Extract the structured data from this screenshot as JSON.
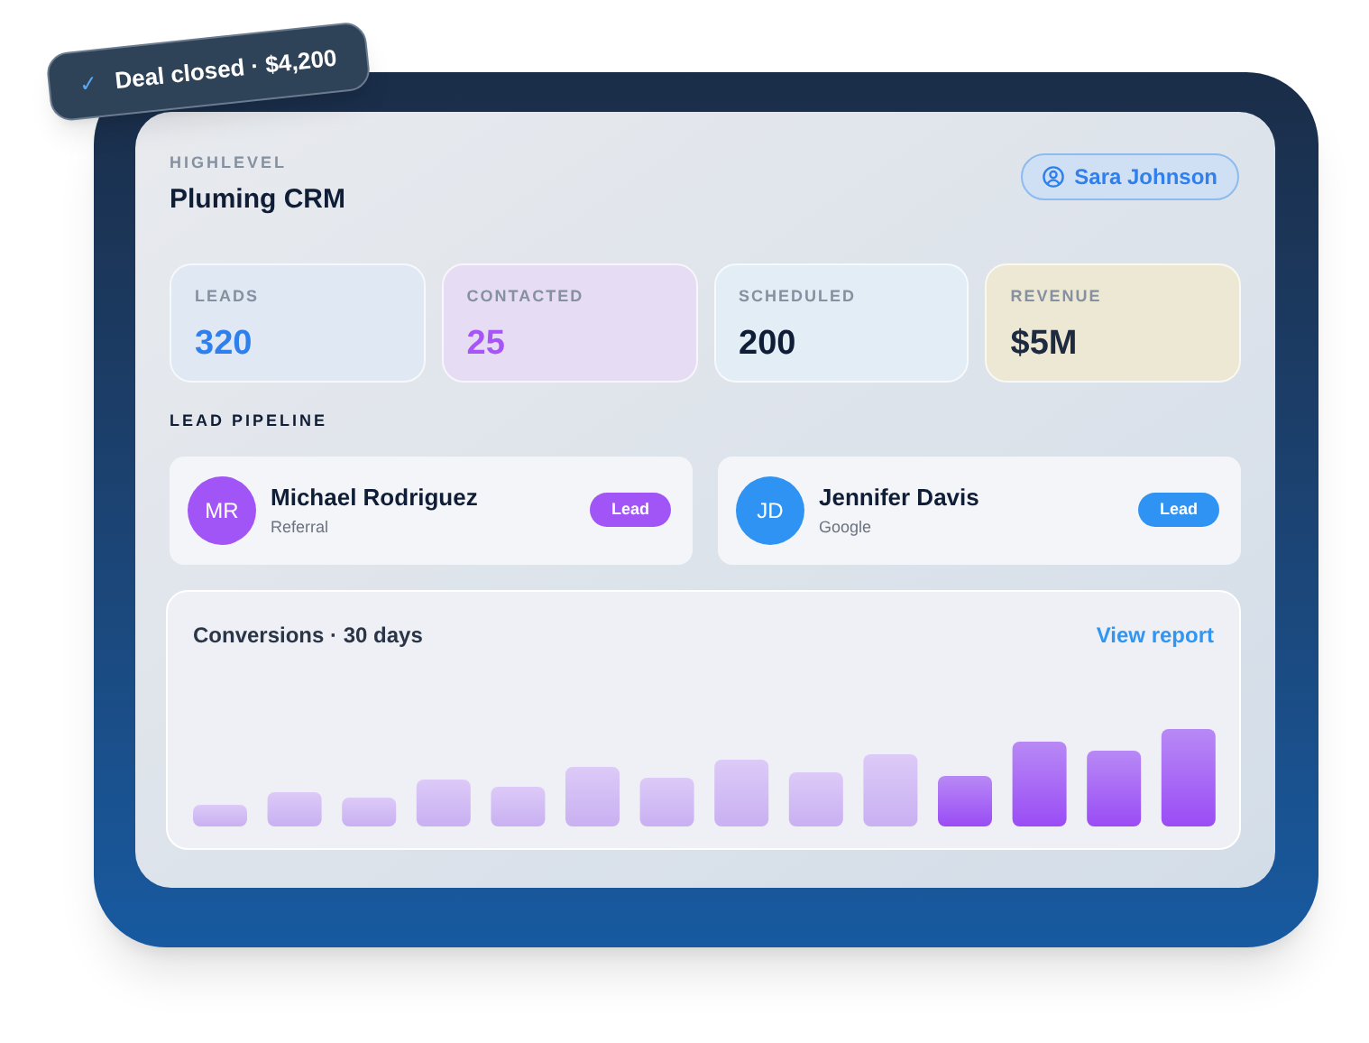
{
  "toast": {
    "icon": "✓",
    "text": "Deal closed · $4,200"
  },
  "header": {
    "brand": "HIGHLEVEL",
    "title": "Pluming CRM",
    "user_button": "Sara Johnson"
  },
  "stats": [
    {
      "kind": "blue",
      "label": "LEADS",
      "value": "320"
    },
    {
      "kind": "purple",
      "label": "CONTACTED",
      "value": "25"
    },
    {
      "kind": "sky",
      "label": "SCHEDULED",
      "value": "200"
    },
    {
      "kind": "sand",
      "label": "REVENUE",
      "value": "$5M"
    }
  ],
  "pipeline": {
    "heading": "LEAD PIPELINE",
    "leads": [
      {
        "initials": "MR",
        "name": "Michael Rodriguez",
        "source": "Referral",
        "badge": "Lead",
        "color": "#a155f6"
      },
      {
        "initials": "JD",
        "name": "Jennifer Davis",
        "source": "Google",
        "badge": "Lead",
        "color": "#2e93f2"
      }
    ]
  },
  "conversions": {
    "title": "Conversions · 30 days",
    "link": "View report"
  }
}
